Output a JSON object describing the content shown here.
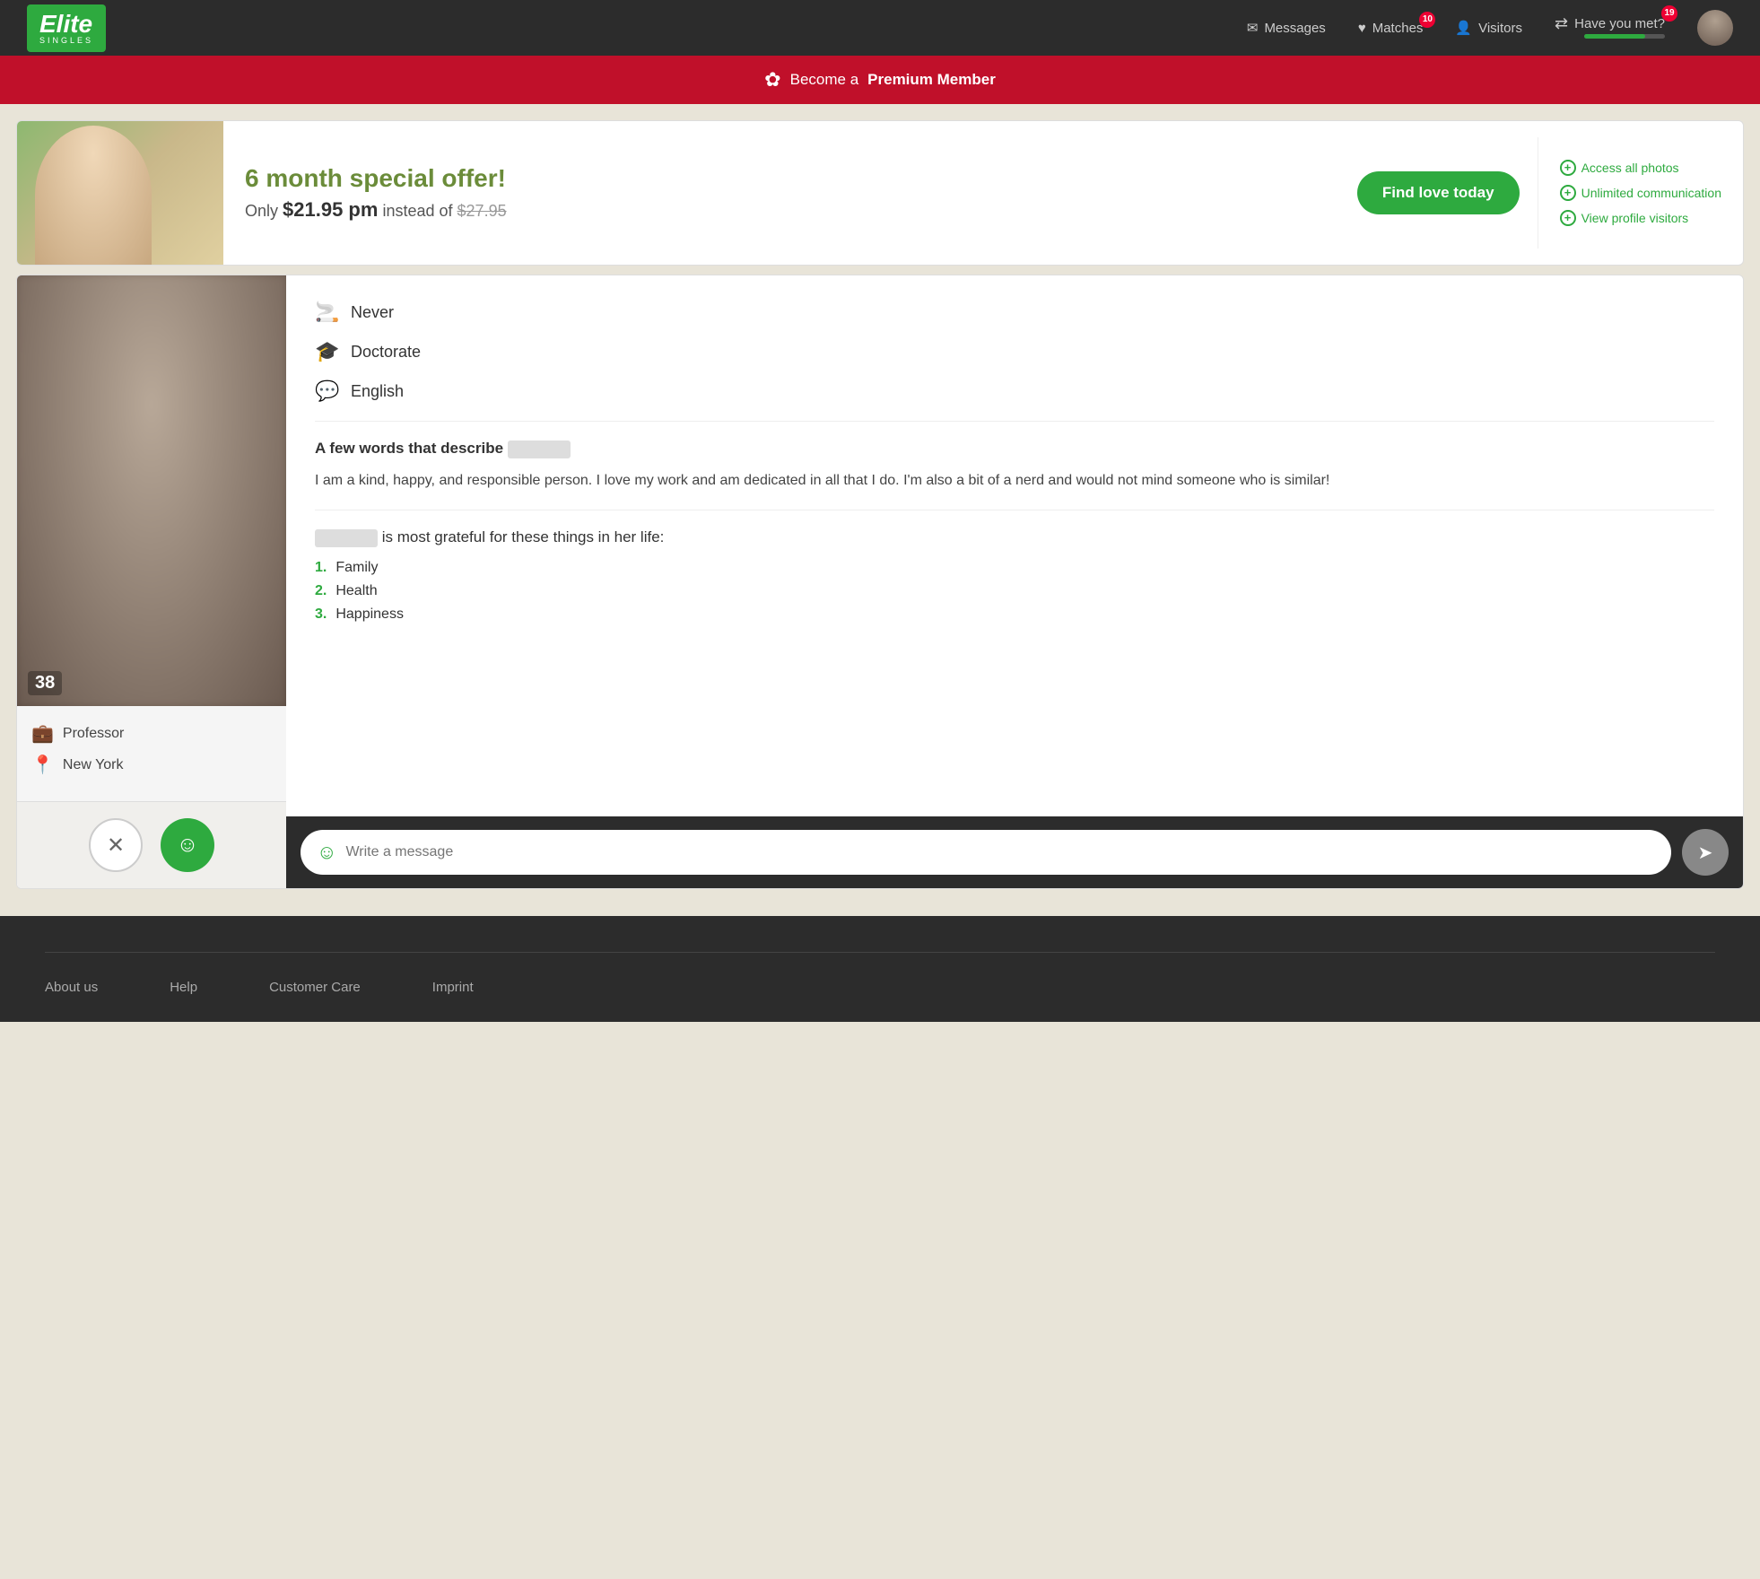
{
  "nav": {
    "logo": "Elite",
    "logo_sub": "SINGLES",
    "messages_label": "Messages",
    "matches_label": "Matches",
    "matches_badge": "10",
    "visitors_label": "Visitors",
    "havent_met_label": "Have you met?",
    "havent_met_badge": "19"
  },
  "premium_banner": {
    "prefix": "Become a",
    "highlight": "Premium Member"
  },
  "offer": {
    "title": "6 month special offer!",
    "price_prefix": "Only",
    "price_new": "$21.95 pm",
    "price_mid": "instead of",
    "price_old": "$27.95",
    "cta": "Find love today",
    "features": [
      "Access all photos",
      "Unlimited communication",
      "View profile visitors"
    ]
  },
  "profile": {
    "age": "38",
    "occupation": "Professor",
    "location": "New York",
    "smoking": "Never",
    "education": "Doctorate",
    "language": "English",
    "describe_label": "A few words that describe",
    "bio": "I am a kind, happy, and responsible person. I love my work and am dedicated in all that I do. I'm also a bit of a nerd and would not mind someone who is similar!",
    "grateful_label": "is most grateful for these things in her life:",
    "grateful_items": [
      "Family",
      "Health",
      "Happiness"
    ]
  },
  "message": {
    "placeholder": "Write a message"
  },
  "footer": {
    "links": [
      "About us",
      "Help",
      "Customer Care",
      "Imprint"
    ]
  }
}
